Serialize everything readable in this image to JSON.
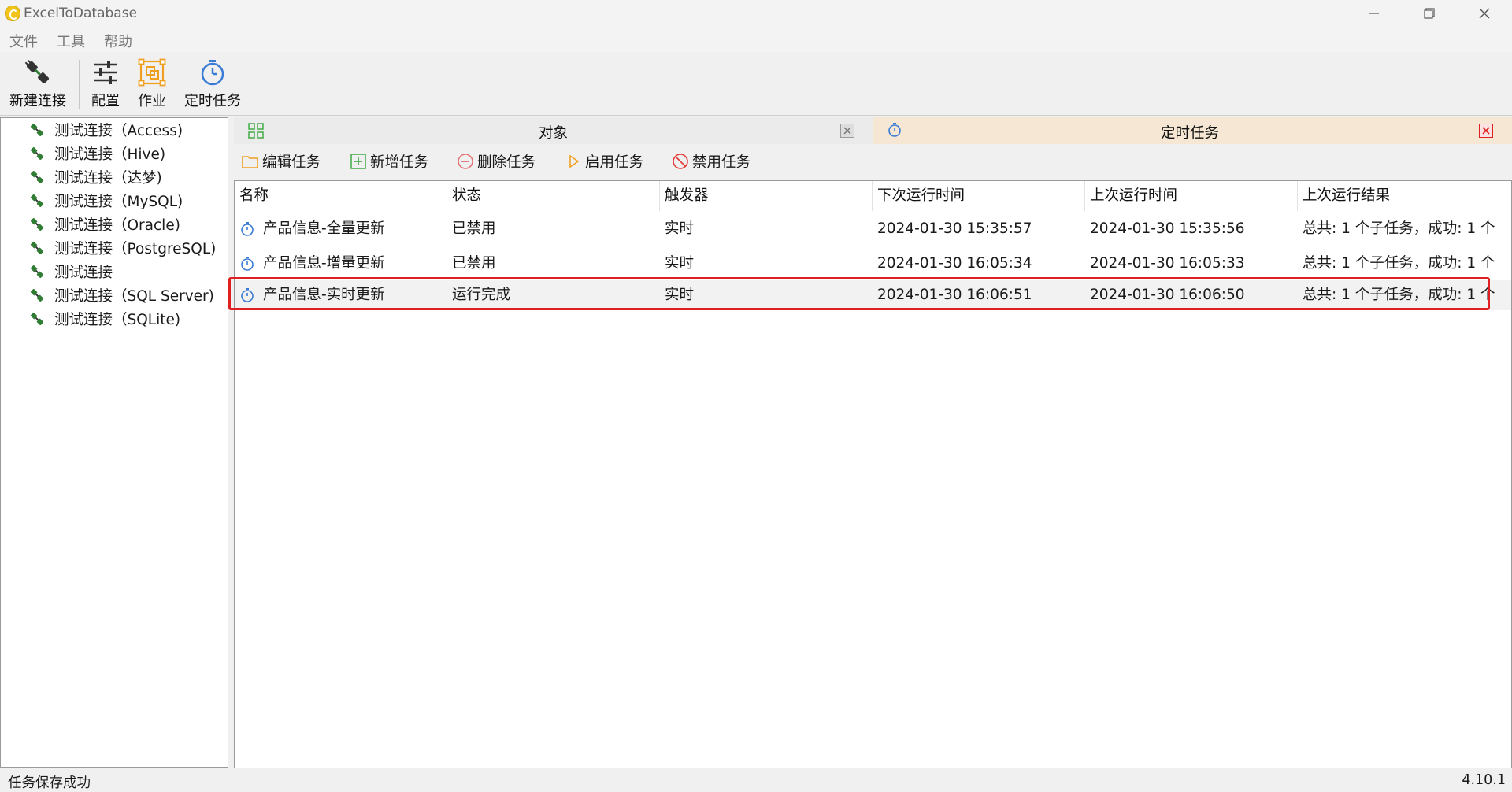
{
  "window": {
    "title": "ExcelToDatabase"
  },
  "menu": {
    "items": [
      {
        "label": "文件"
      },
      {
        "label": "工具"
      },
      {
        "label": "帮助"
      }
    ]
  },
  "toolbar": {
    "new_connection_label": "新建连接",
    "config_label": "配置",
    "job_label": "作业",
    "scheduled_task_label": "定时任务"
  },
  "sidebar": {
    "items": [
      {
        "label": "测试连接（Access)",
        "icon": "connection-icon"
      },
      {
        "label": "测试连接（Hive)",
        "icon": "connection-icon"
      },
      {
        "label": "测试连接（达梦)",
        "icon": "connection-icon"
      },
      {
        "label": "测试连接（MySQL)",
        "icon": "connection-icon"
      },
      {
        "label": "测试连接（Oracle)",
        "icon": "connection-icon"
      },
      {
        "label": "测试连接（PostgreSQL)",
        "icon": "connection-icon"
      },
      {
        "label": "测试连接",
        "icon": "connection-icon"
      },
      {
        "label": "测试连接（SQL Server)",
        "icon": "connection-icon"
      },
      {
        "label": "测试连接（SQLite)",
        "icon": "connection-icon"
      }
    ]
  },
  "tabs": [
    {
      "label": "对象",
      "icon": "grid-icon"
    },
    {
      "label": "定时任务",
      "icon": "stopwatch-icon",
      "active": true
    }
  ],
  "actions": {
    "edit": "编辑任务",
    "add": "新增任务",
    "delete": "删除任务",
    "enable": "启用任务",
    "disable": "禁用任务"
  },
  "table": {
    "columns": [
      "名称",
      "状态",
      "触发器",
      "下次运行时间",
      "上次运行时间",
      "上次运行结果"
    ],
    "rows": [
      {
        "name": "产品信息-全量更新",
        "status": "已禁用",
        "trigger": "实时",
        "next_run": "2024-01-30 15:35:57",
        "last_run": "2024-01-30 15:35:56",
        "last_result": "总共: 1 个子任务，成功: 1 个"
      },
      {
        "name": "产品信息-增量更新",
        "status": "已禁用",
        "trigger": "实时",
        "next_run": "2024-01-30 16:05:34",
        "last_run": "2024-01-30 16:05:33",
        "last_result": "总共: 1 个子任务，成功: 1 个"
      },
      {
        "name": "产品信息-实时更新",
        "status": "运行完成",
        "trigger": "实时",
        "next_run": "2024-01-30 16:06:51",
        "last_run": "2024-01-30 16:06:50",
        "last_result": "总共: 1 个子任务，成功: 1 个",
        "selected": true
      }
    ]
  },
  "status": {
    "message": "任务保存成功",
    "version": "4.10.1"
  },
  "colors": {
    "accent_orange": "#f0a020",
    "accent_blue": "#3a7bd5",
    "highlight_red": "#e02020",
    "connection_green": "#2e7d32",
    "active_tab_bg": "#f5e7d3"
  }
}
